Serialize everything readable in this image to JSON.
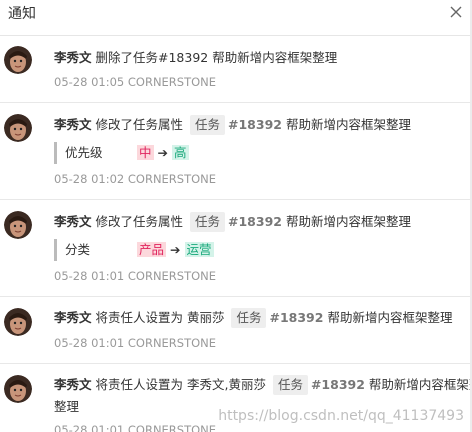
{
  "header": {
    "title": "通知"
  },
  "notifications": [
    {
      "user": "李秀文",
      "action": "删除了任务#18392 帮助新增内容框架整理",
      "meta": "05-28 01:05 CORNERSTONE"
    },
    {
      "user": "李秀文",
      "action": "修改了任务属性",
      "tag": "任务",
      "task_no": "#18392",
      "task_title": "帮助新增内容框架整理",
      "change": {
        "field": "优先级",
        "old": "中",
        "new": "高"
      },
      "meta": "05-28 01:02 CORNERSTONE"
    },
    {
      "user": "李秀文",
      "action": "修改了任务属性",
      "tag": "任务",
      "task_no": "#18392",
      "task_title": "帮助新增内容框架整理",
      "change": {
        "field": "分类",
        "old": "产品",
        "new": "运营"
      },
      "meta": "05-28 01:01 CORNERSTONE"
    },
    {
      "user": "李秀文",
      "action": "将责任人设置为 黄丽莎",
      "tag": "任务",
      "task_no": "#18392",
      "task_title": "帮助新增内容框架整理",
      "meta": "05-28 01:01 CORNERSTONE"
    },
    {
      "user": "李秀文",
      "action": "将责任人设置为 李秀文,黄丽莎",
      "tag": "任务",
      "task_no": "#18392",
      "task_title": "帮助新增内容框架整",
      "task_title_wrap": "整理",
      "meta": "05-28 01:01 CORNERSTONE"
    }
  ],
  "watermark": "https://blog.csdn.net/qq_41137493",
  "colors": {
    "old_bg": "#fcd8dc",
    "old_fg": "#e0245e",
    "new_bg": "#d4f3e9",
    "new_fg": "#19a97b"
  }
}
